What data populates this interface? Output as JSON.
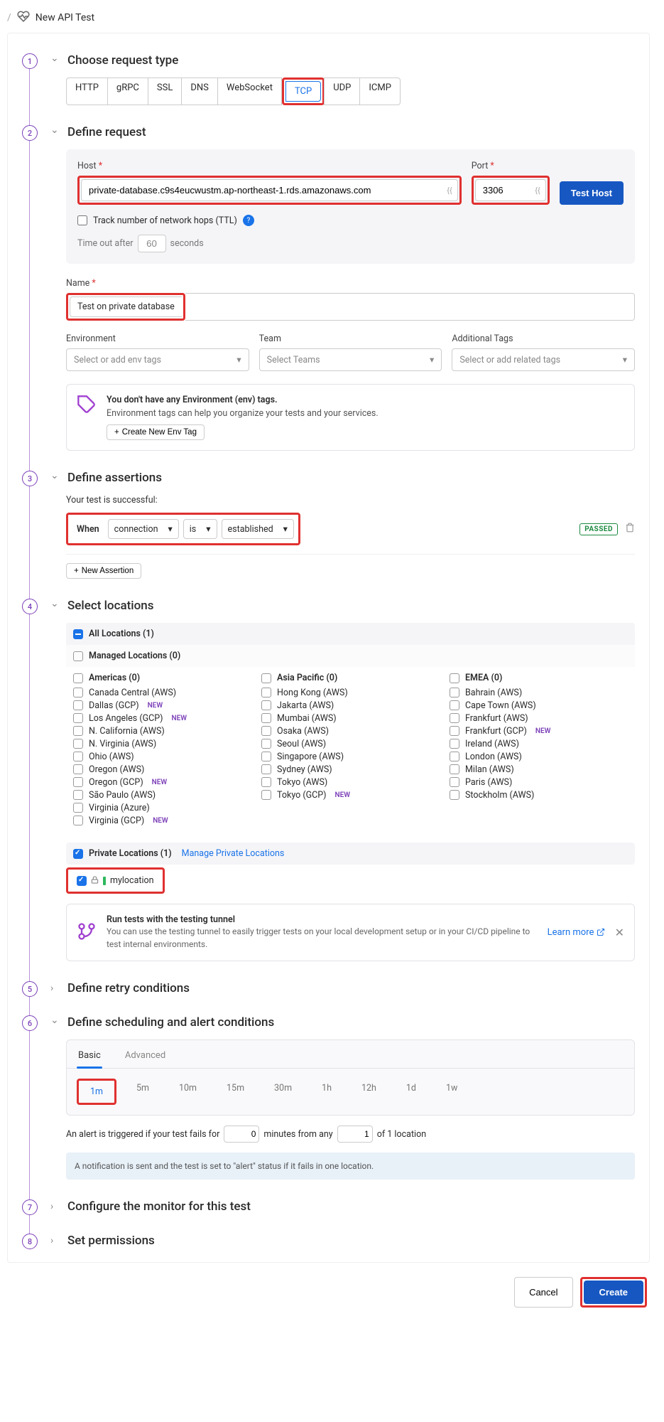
{
  "header": {
    "title": "New API Test"
  },
  "steps": {
    "s1": {
      "title": "Choose request type"
    },
    "s2": {
      "title": "Define request"
    },
    "s3": {
      "title": "Define assertions"
    },
    "s4": {
      "title": "Select locations"
    },
    "s5": {
      "title": "Define retry conditions"
    },
    "s6": {
      "title": "Define scheduling and alert conditions"
    },
    "s7": {
      "title": "Configure the monitor for this test"
    },
    "s8": {
      "title": "Set permissions"
    }
  },
  "request_types": [
    "HTTP",
    "gRPC",
    "SSL",
    "DNS",
    "WebSocket",
    "TCP",
    "UDP",
    "ICMP"
  ],
  "request_type_active": "TCP",
  "define_request": {
    "host_label": "Host",
    "host_value": "private-database.c9s4eucwustm.ap-northeast-1.rds.amazonaws.com",
    "port_label": "Port",
    "port_value": "3306",
    "test_host_btn": "Test Host",
    "track_ttl": "Track number of network hops (TTL)",
    "timeout_prefix": "Time out after",
    "timeout_value": "60",
    "timeout_suffix": "seconds",
    "name_label": "Name",
    "name_value": "Test on private database",
    "env_label": "Environment",
    "env_placeholder": "Select or add env tags",
    "team_label": "Team",
    "team_placeholder": "Select Teams",
    "tags_label": "Additional Tags",
    "tags_placeholder": "Select or add related tags",
    "env_card_title": "You don't have any Environment (env) tags.",
    "env_card_sub": "Environment tags can help you organize your tests and your services.",
    "env_card_btn": "Create New Env Tag"
  },
  "assertions": {
    "intro": "Your test is successful:",
    "when_label": "When",
    "prop": "connection",
    "op": "is",
    "val": "established",
    "passed": "PASSED",
    "new_btn": "New Assertion"
  },
  "locations": {
    "all_label": "All Locations (1)",
    "managed_label": "Managed Locations (0)",
    "americas_label": "Americas (0)",
    "asia_label": "Asia Pacific (0)",
    "emea_label": "EMEA (0)",
    "americas": [
      {
        "name": "Canada Central (AWS)"
      },
      {
        "name": "Dallas (GCP)",
        "new": true
      },
      {
        "name": "Los Angeles (GCP)",
        "new": true
      },
      {
        "name": "N. California (AWS)"
      },
      {
        "name": "N. Virginia (AWS)"
      },
      {
        "name": "Ohio (AWS)"
      },
      {
        "name": "Oregon (AWS)"
      },
      {
        "name": "Oregon (GCP)",
        "new": true
      },
      {
        "name": "São Paulo (AWS)"
      },
      {
        "name": "Virginia (Azure)"
      },
      {
        "name": "Virginia (GCP)",
        "new": true
      }
    ],
    "asia": [
      {
        "name": "Hong Kong (AWS)"
      },
      {
        "name": "Jakarta (AWS)"
      },
      {
        "name": "Mumbai (AWS)"
      },
      {
        "name": "Osaka (AWS)"
      },
      {
        "name": "Seoul (AWS)"
      },
      {
        "name": "Singapore (AWS)"
      },
      {
        "name": "Sydney (AWS)"
      },
      {
        "name": "Tokyo (AWS)"
      },
      {
        "name": "Tokyo (GCP)",
        "new": true
      }
    ],
    "emea": [
      {
        "name": "Bahrain (AWS)"
      },
      {
        "name": "Cape Town (AWS)"
      },
      {
        "name": "Frankfurt (AWS)"
      },
      {
        "name": "Frankfurt (GCP)",
        "new": true
      },
      {
        "name": "Ireland (AWS)"
      },
      {
        "name": "London (AWS)"
      },
      {
        "name": "Milan (AWS)"
      },
      {
        "name": "Paris (AWS)"
      },
      {
        "name": "Stockholm (AWS)"
      }
    ],
    "private_label": "Private Locations (1)",
    "manage_link": "Manage Private Locations",
    "private_item": "mylocation",
    "new_text": "NEW",
    "tunnel_title": "Run tests with the testing tunnel",
    "tunnel_sub": "You can use the testing tunnel to easily trigger tests on your local development setup or in your CI/CD pipeline to test internal environments.",
    "learn_more": "Learn more"
  },
  "schedule": {
    "tab_basic": "Basic",
    "tab_advanced": "Advanced",
    "intervals": [
      "1m",
      "5m",
      "10m",
      "15m",
      "30m",
      "1h",
      "12h",
      "1d",
      "1w"
    ],
    "interval_active": "1m",
    "alert_p1": "An alert is triggered if your test fails for",
    "alert_mins": "0",
    "alert_p2": "minutes from any",
    "alert_locs": "1",
    "alert_p3": "of 1 location",
    "note": "A notification is sent and the test is set to \"alert\" status if it fails in one location."
  },
  "footer": {
    "cancel": "Cancel",
    "create": "Create"
  }
}
